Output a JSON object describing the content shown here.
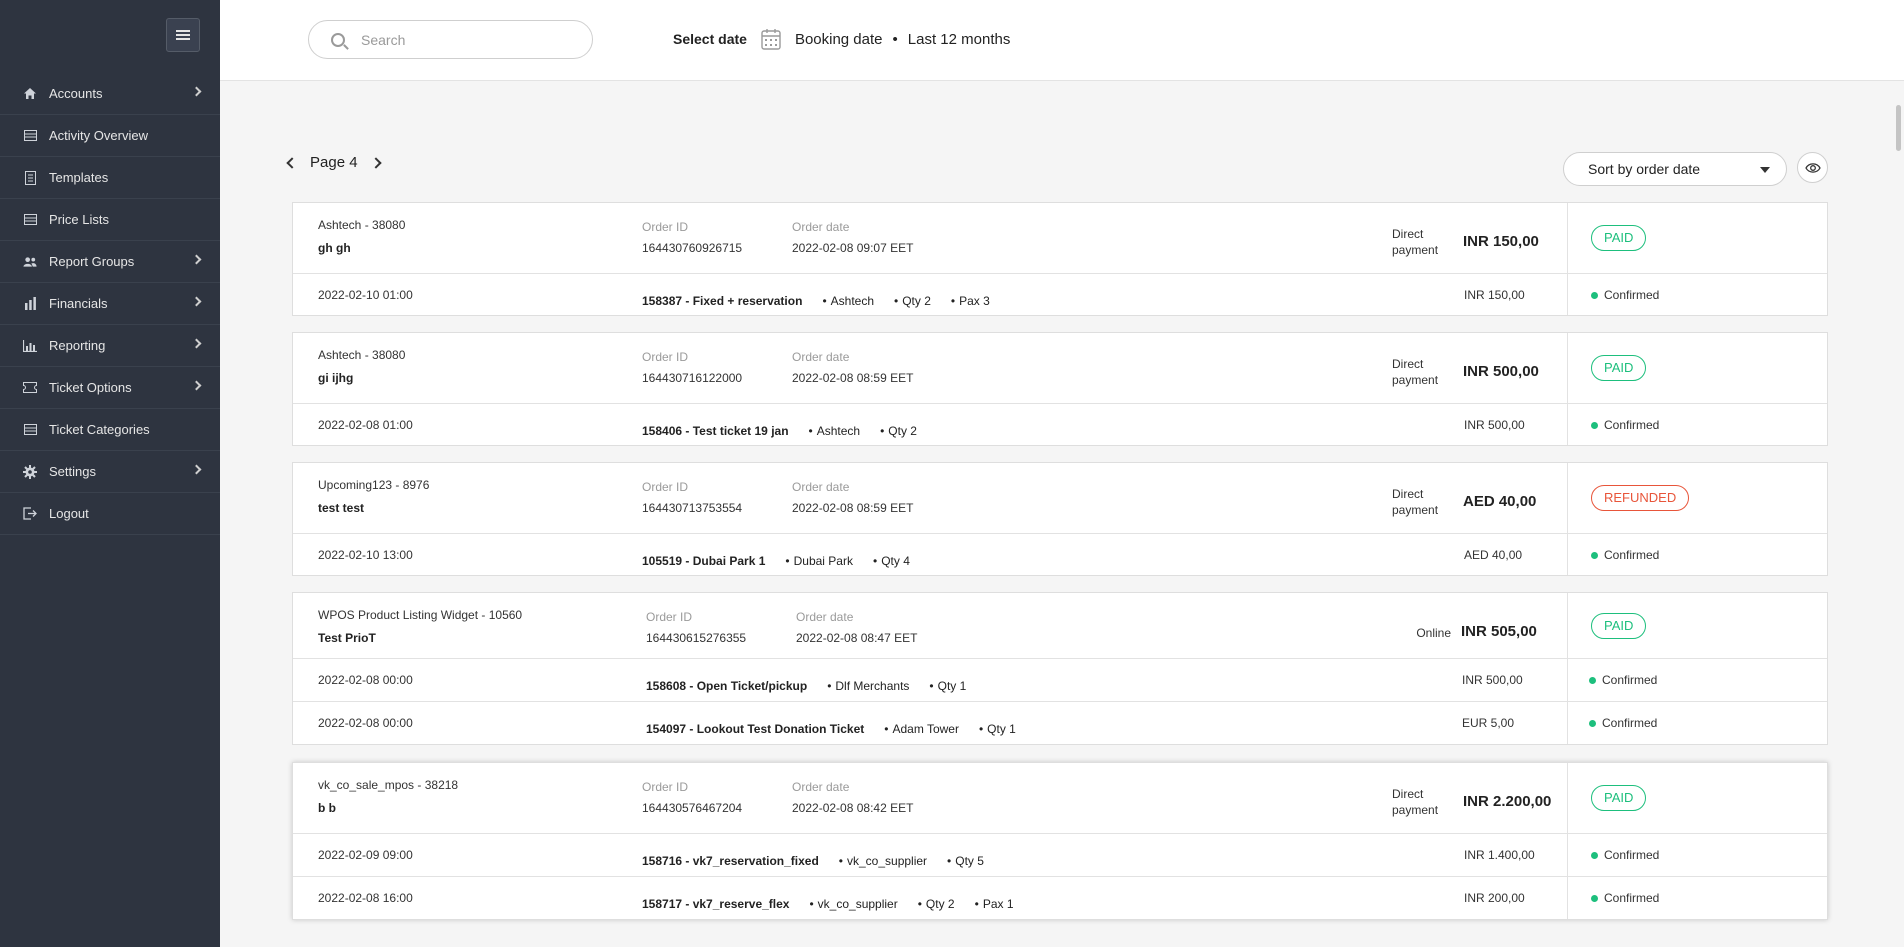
{
  "sidebar": {
    "items": [
      {
        "label": "Accounts",
        "icon": "home-icon",
        "has_submenu": true
      },
      {
        "label": "Activity Overview",
        "icon": "list-icon",
        "has_submenu": false
      },
      {
        "label": "Templates",
        "icon": "document-icon",
        "has_submenu": false
      },
      {
        "label": "Price Lists",
        "icon": "list-icon",
        "has_submenu": false
      },
      {
        "label": "Report Groups",
        "icon": "users-icon",
        "has_submenu": true
      },
      {
        "label": "Financials",
        "icon": "bar-chart-icon",
        "has_submenu": true
      },
      {
        "label": "Reporting",
        "icon": "line-chart-icon",
        "has_submenu": true
      },
      {
        "label": "Ticket Options",
        "icon": "ticket-icon",
        "has_submenu": true
      },
      {
        "label": "Ticket Categories",
        "icon": "list-icon",
        "has_submenu": false
      },
      {
        "label": "Settings",
        "icon": "gear-icon",
        "has_submenu": true
      },
      {
        "label": "Logout",
        "icon": "logout-icon",
        "has_submenu": false
      }
    ]
  },
  "topbar": {
    "search_placeholder": "Search",
    "select_date_label": "Select date",
    "date_type": "Booking date",
    "separator": "•",
    "date_range": "Last 12 months"
  },
  "pager": {
    "label": "Page 4"
  },
  "sort": {
    "label": "Sort by order date"
  },
  "orders": [
    {
      "account": "Ashtech - 38080",
      "customer": "gh gh",
      "order_id_label": "Order ID",
      "order_id": "164430760926715",
      "order_date_label": "Order date",
      "order_date": "2022-02-08 09:07 EET",
      "payment": "Direct payment",
      "total": "INR 150,00",
      "status": "PAID",
      "lines": [
        {
          "date": "2022-02-10 01:00",
          "product": "158387 - Fixed + reservation",
          "meta": [
            "Ashtech",
            "Qty 2",
            "Pax 3"
          ],
          "amount": "INR 150,00",
          "state": "Confirmed"
        }
      ]
    },
    {
      "account": "Ashtech - 38080",
      "customer": "gi ijhg",
      "order_id_label": "Order ID",
      "order_id": "164430716122000",
      "order_date_label": "Order date",
      "order_date": "2022-02-08 08:59 EET",
      "payment": "Direct payment",
      "total": "INR 500,00",
      "status": "PAID",
      "lines": [
        {
          "date": "2022-02-08 01:00",
          "product": "158406 - Test ticket 19 jan",
          "meta": [
            "Ashtech",
            "Qty 2"
          ],
          "amount": "INR 500,00",
          "state": "Confirmed"
        }
      ]
    },
    {
      "account": "Upcoming123 - 8976",
      "customer": "test test",
      "order_id_label": "Order ID",
      "order_id": "164430713753554",
      "order_date_label": "Order date",
      "order_date": "2022-02-08 08:59 EET",
      "payment": "Direct payment",
      "total": "AED 40,00",
      "status": "REFUNDED",
      "lines": [
        {
          "date": "2022-02-10 13:00",
          "product": "105519 - Dubai Park 1",
          "meta": [
            "Dubai Park",
            "Qty 4"
          ],
          "amount": "AED 40,00",
          "state": "Confirmed"
        }
      ]
    },
    {
      "account": "WPOS Product Listing Widget - 10560",
      "customer": "Test PrioT",
      "order_id_label": "Order ID",
      "order_id": "164430615276355",
      "order_date_label": "Order date",
      "order_date": "2022-02-08 08:47 EET",
      "payment": "Online",
      "total": "INR 505,00",
      "status": "PAID",
      "lines": [
        {
          "date": "2022-02-08 00:00",
          "product": "158608 - Open Ticket/pickup",
          "meta": [
            "Dlf Merchants",
            "Qty 1"
          ],
          "amount": "INR 500,00",
          "state": "Confirmed"
        },
        {
          "date": "2022-02-08 00:00",
          "product": "154097 - Lookout Test Donation Ticket",
          "meta": [
            "Adam Tower",
            "Qty 1"
          ],
          "amount": "EUR 5,00",
          "state": "Confirmed"
        }
      ]
    },
    {
      "account": "vk_co_sale_mpos - 38218",
      "customer": "b b",
      "order_id_label": "Order ID",
      "order_id": "164430576467204",
      "order_date_label": "Order date",
      "order_date": "2022-02-08 08:42 EET",
      "payment": "Direct payment",
      "total": "INR 2.200,00",
      "status": "PAID",
      "lines": [
        {
          "date": "2022-02-09 09:00",
          "product": "158716 - vk7_reservation_fixed",
          "meta": [
            "vk_co_supplier",
            "Qty 5"
          ],
          "amount": "INR 1.400,00",
          "state": "Confirmed"
        },
        {
          "date": "2022-02-08 16:00",
          "product": "158717 - vk7_reserve_flex",
          "meta": [
            "vk_co_supplier",
            "Qty 2",
            "Pax 1"
          ],
          "amount": "INR 200,00",
          "state": "Confirmed"
        }
      ]
    }
  ],
  "colors": {
    "sidebar": "#2e3440",
    "paid": "#1dbf7d",
    "refunded": "#e8553a",
    "confirmed_dot": "#1dbf7d"
  }
}
